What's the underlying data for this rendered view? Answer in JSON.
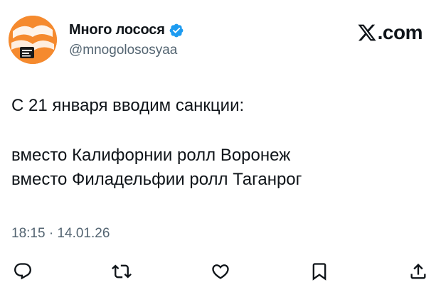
{
  "author": {
    "display_name": "Много лосося",
    "handle": "@mnogolososyaa",
    "verified": true,
    "avatar_icon": "avatar-logo"
  },
  "brand": {
    "site_text": ".com",
    "logo_icon": "x-logo-icon"
  },
  "tweet": {
    "lines": [
      "С 21 января вводим санкции:",
      "",
      "вместо Калифорнии ролл Воронеж",
      "вместо Филадельфии ролл Таганрог"
    ],
    "timestamp": "18:15 · 14.01.26"
  },
  "actions": [
    {
      "name": "reply",
      "icon": "reply-icon"
    },
    {
      "name": "retweet",
      "icon": "retweet-icon"
    },
    {
      "name": "like",
      "icon": "like-icon"
    },
    {
      "name": "bookmark",
      "icon": "bookmark-icon"
    },
    {
      "name": "share",
      "icon": "share-icon"
    }
  ],
  "colors": {
    "text": "#0f1419",
    "secondary": "#536471",
    "verified": "#1d9bf0",
    "avatar": "#f58a2e"
  }
}
